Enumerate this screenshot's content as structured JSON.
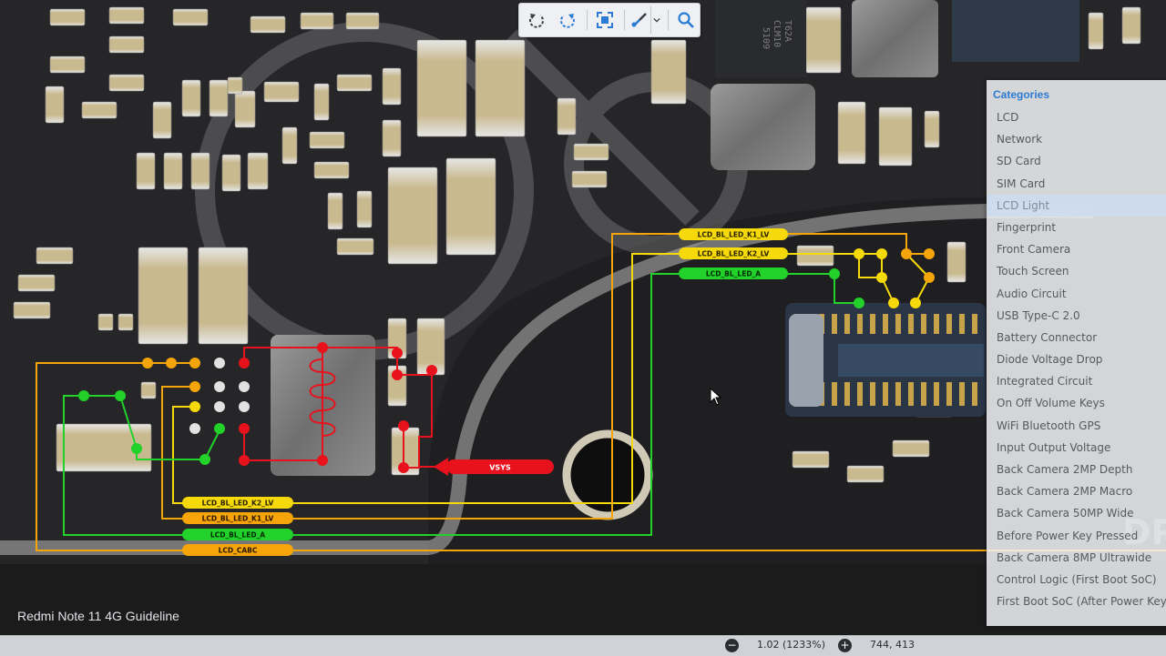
{
  "toolbar": {
    "buttons": [
      {
        "name": "rotate-left",
        "icon": "rotate-left-icon"
      },
      {
        "name": "rotate-right",
        "icon": "rotate-right-icon"
      },
      {
        "name": "fit-screen",
        "icon": "fit-screen-icon"
      },
      {
        "name": "highlight-tool",
        "icon": "brush-icon"
      },
      {
        "name": "search",
        "icon": "search-icon"
      }
    ]
  },
  "categories": {
    "title": "Categories",
    "selected": "LCD Light",
    "items": [
      "LCD",
      "Network",
      "SD Card",
      "SIM Card",
      "LCD Light",
      "Fingerprint",
      "Front Camera",
      "Touch Screen",
      "Audio Circuit",
      "USB Type-C 2.0",
      "Battery Connector",
      "Diode Voltage Drop",
      "Integrated Circuit",
      "On Off Volume Keys",
      "WiFi Bluetooth GPS",
      "Input Output Voltage",
      "Back Camera 2MP Depth",
      "Back Camera 2MP Macro",
      "Back Camera 50MP Wide",
      "Before Power Key Pressed",
      "Back Camera 8MP Ultrawide",
      "Control Logic (First Boot SoC)",
      "First Boot SoC (After Power Key P"
    ]
  },
  "board": {
    "guideline_title": "Redmi Note 11 4G Guideline",
    "chip_marking": [
      "5109",
      "CLM10",
      "T62A"
    ],
    "watermark": "DP",
    "labels": {
      "top_k1": "LCD_BL_LED_K1_LV",
      "top_k2": "LCD_BL_LED_K2_LV",
      "top_a": "LCD_BL_LED_A",
      "bot_k2": "LCD_BL_LED_K2_LV",
      "bot_k1": "LCD_BL_LED_K1_LV",
      "bot_a": "LCD_BL_LED_A",
      "bot_cabc": "LCD_CABC",
      "vsys": "VSYS"
    },
    "colors": {
      "yellow": "#f5d90a",
      "orange": "#f5a40a",
      "green": "#22d12a",
      "red": "#e8121c",
      "board": "#1f1f21",
      "accent": "#2b7bd6"
    }
  },
  "status": {
    "zoom": "1.02 (1233%)",
    "coords": "744, 413",
    "zoom_out": "−",
    "zoom_in": "+"
  }
}
